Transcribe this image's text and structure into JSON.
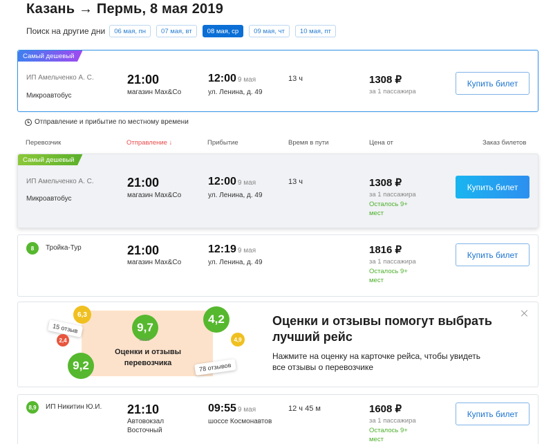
{
  "header": {
    "title": "Казань → Пермь, 8 мая 2019"
  },
  "date_search": {
    "label": "Поиск на другие дни",
    "dates": [
      "06 мая, пн",
      "07 мая, вт",
      "08 мая, ср",
      "09 мая, чт",
      "10 мая, пт"
    ],
    "selected": "08 мая, ср"
  },
  "top_trip": {
    "badge": "Самый дешевый",
    "carrier": "ИП Амельченко А. С.",
    "bus": "Микроавтобус",
    "departure_time": "21:00",
    "departure_place": "магазин Max&Co",
    "arrival_time": "12:00",
    "arrival_date": "9 мая",
    "arrival_place": "ул. Ленина, д. 49",
    "duration": "13 ч",
    "price": "1308 ₽",
    "per_passenger": "за 1 пассажира",
    "buy_label": "Купить билет"
  },
  "local_time_note": "Отправление и прибытие по местному времени",
  "columns": {
    "carrier": "Перевозчик",
    "departure": "Отправление ↓",
    "arrival": "Прибытие",
    "duration": "Время в пути",
    "price": "Цена от",
    "booking": "Заказ билетов"
  },
  "trips": [
    {
      "badge": "Самый дешевый",
      "carrier": "ИП Амельченко А. С.",
      "bus": "Микроавтобус",
      "departure_time": "21:00",
      "departure_place": "магазин Max&Co",
      "arrival_time": "12:00",
      "arrival_date": "9 мая",
      "arrival_place": "ул. Ленина, д. 49",
      "duration": "13 ч",
      "price": "1308 ₽",
      "per_passenger": "за 1 пассажира",
      "seats_left_1": "Осталось 9+",
      "seats_left_2": "мест",
      "buy_label": "Купить билет"
    },
    {
      "rating": "8",
      "carrier": "Тройка-Тур",
      "departure_time": "21:00",
      "departure_place": "магазин Max&Co",
      "arrival_time": "12:19",
      "arrival_date": "9 мая",
      "arrival_place": "ул. Ленина, д. 49",
      "price": "1816 ₽",
      "per_passenger": "за 1 пассажира",
      "seats_left_1": "Осталось 9+",
      "seats_left_2": "мест",
      "buy_label": "Купить билет"
    },
    {
      "rating": "8,9",
      "carrier": "ИП Никитин Ю.И.",
      "departure_time": "21:10",
      "departure_place_1": "Автовокзал",
      "departure_place_2": "Восточный",
      "arrival_time": "09:55",
      "arrival_date": "9 мая",
      "arrival_place": "шоссе Космонавтов",
      "duration": "12 ч 45 м",
      "price": "1608 ₽",
      "per_passenger": "за 1 пассажира",
      "seats_left_1": "Осталось 9+",
      "seats_left_2": "мест",
      "buy_label": "Купить билет"
    }
  ],
  "promo": {
    "main_rating": "9,7",
    "main_rating_sub": "из 10",
    "card_title_1": "Оценки и отзывы",
    "card_title_2": "перевозчика",
    "rating_left_top": "6,3",
    "rating_left_mid": "2,4",
    "rating_left_big": "9,2",
    "rating_right_big": "4,2",
    "rating_right_small": "4,9",
    "reviews_left": "15 отзыв",
    "reviews_right": "78 отзывов",
    "heading_1": "Оценки и отзывы помогут выбрать",
    "heading_2": "лучший рейс",
    "text_1": "Нажмите на оценку на карточке рейса, чтобы увидеть",
    "text_2": "все отзывы о перевозчике"
  },
  "colors": {
    "accent_blue": "#0b6fd6",
    "rating_green": "#56b82e",
    "seats_green": "#4caf2a",
    "sort_red": "#e84b4b"
  }
}
